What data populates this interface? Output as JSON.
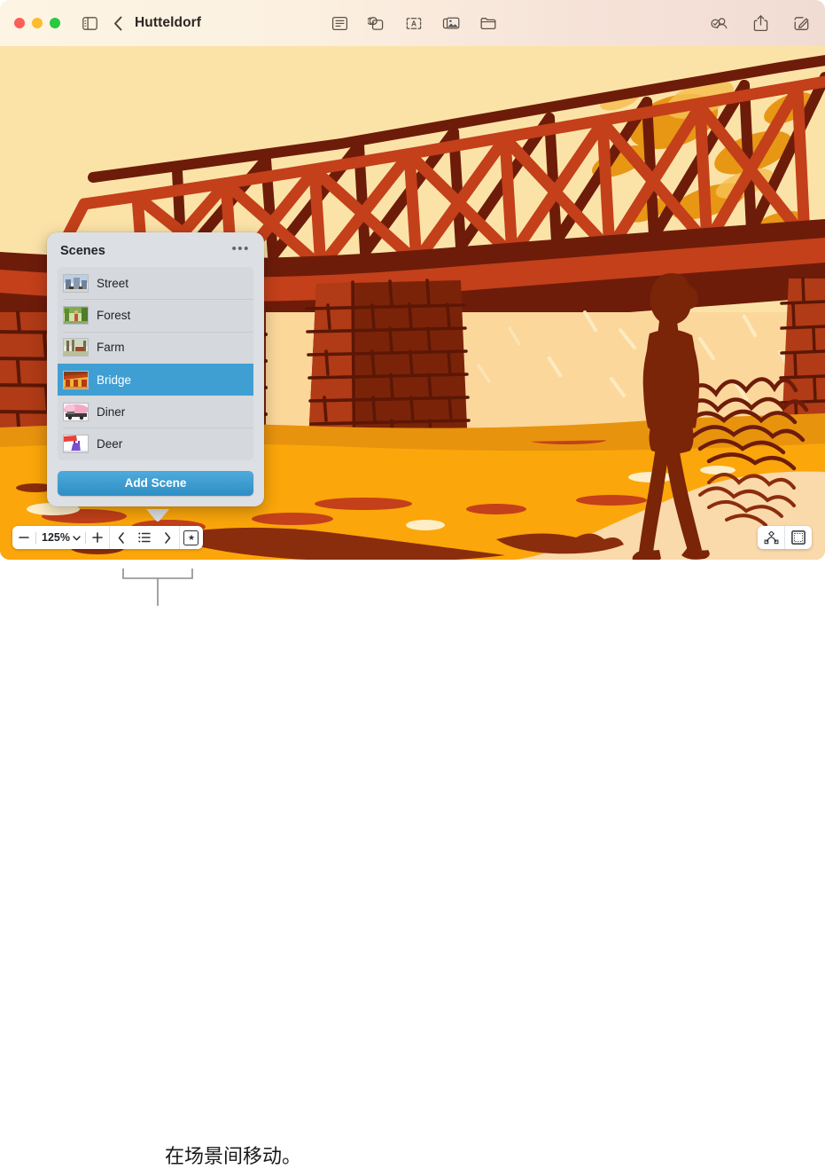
{
  "window": {
    "title": "Hutteldorf",
    "traffic_lights": [
      {
        "name": "close",
        "color": "#fc5f57"
      },
      {
        "name": "minimize",
        "color": "#fdbc2e"
      },
      {
        "name": "maximize",
        "color": "#29c940"
      }
    ],
    "back_label": "‹"
  },
  "toolbar": {
    "sidebar_toggle": "sidebar-icon",
    "center_items": [
      {
        "name": "text-box-icon",
        "label": "Text"
      },
      {
        "name": "shape-icon",
        "label": "Shape"
      },
      {
        "name": "text-frame-icon",
        "label": "Text Frame"
      },
      {
        "name": "media-icon",
        "label": "Media"
      },
      {
        "name": "folder-icon",
        "label": "Folder"
      }
    ],
    "right_items": [
      {
        "name": "collaborate-icon",
        "label": "Collaborate"
      },
      {
        "name": "share-icon",
        "label": "Share"
      },
      {
        "name": "markup-icon",
        "label": "Markup"
      }
    ]
  },
  "popover": {
    "title": "Scenes",
    "more_label": "•••",
    "add_button": "Add Scene",
    "accent_color": "#3f9fd2",
    "scenes": [
      {
        "label": "Street",
        "selected": false
      },
      {
        "label": "Forest",
        "selected": false
      },
      {
        "label": "Farm",
        "selected": false
      },
      {
        "label": "Bridge",
        "selected": true
      },
      {
        "label": "Diner",
        "selected": false
      },
      {
        "label": "Deer",
        "selected": false
      }
    ]
  },
  "zoombar": {
    "zoom_out": "−",
    "zoom_level": "125%",
    "zoom_in": "+",
    "prev_scene": "‹",
    "scene_list": "list-icon",
    "next_scene": "›",
    "favorite": "★"
  },
  "bottom_right": {
    "items": [
      {
        "name": "animate-icon",
        "label": "Animate"
      },
      {
        "name": "format-icon",
        "label": "Format"
      }
    ]
  },
  "callout": {
    "text": "在场景间移动。"
  },
  "artwork": {
    "name": "bridge-scene-illustration",
    "colors": {
      "sky": "#fbe3a8",
      "sky_light": "#fcedc6",
      "bridge_red": "#c3401a",
      "bridge_dark": "#6e1c0a",
      "water": "#fba60a",
      "water_dark": "#8a2d0c",
      "sand": "#fad9ab",
      "brick": "#b03b16",
      "brick_dark": "#7b2309",
      "figure": "#7a2408",
      "accent_orange": "#e8930e"
    }
  }
}
